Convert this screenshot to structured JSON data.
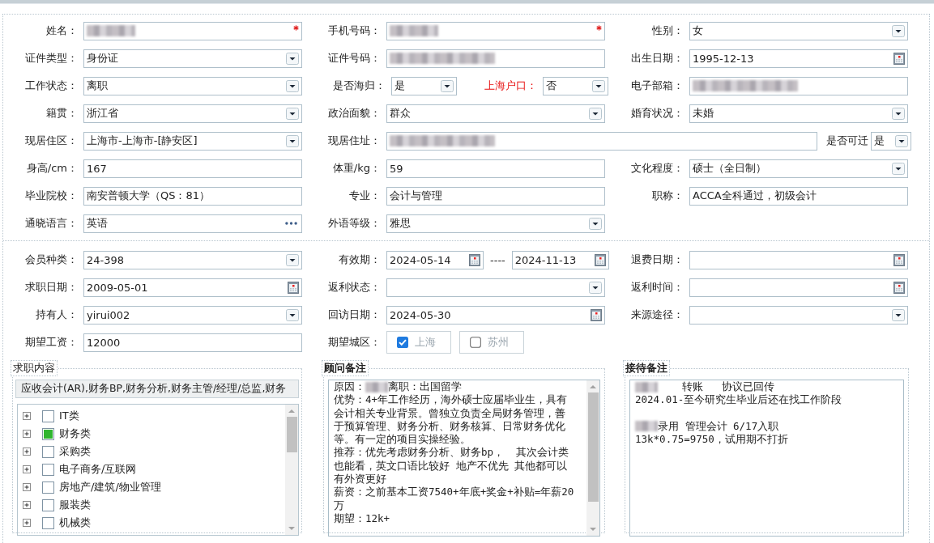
{
  "sections": [
    {
      "rows": [
        [
          {
            "label": "姓名：",
            "kind": "text",
            "redacted": true,
            "required": true
          },
          {
            "label": "手机号码：",
            "kind": "text",
            "redacted": true,
            "required": true
          },
          {
            "label": "性别：",
            "kind": "select",
            "value": "女"
          }
        ],
        [
          {
            "label": "证件类型：",
            "kind": "select",
            "value": "身份证"
          },
          {
            "label": "证件号码：",
            "kind": "text",
            "redacted": true
          },
          {
            "label": "出生日期：",
            "kind": "date",
            "value": "1995-12-13"
          }
        ],
        [
          {
            "label": "工作状态：",
            "kind": "select",
            "value": "离职"
          },
          {
            "label": "是否海归：",
            "kind": "select-short",
            "value": "是"
          },
          {
            "label": "上海户口：",
            "kind": "select-short",
            "value": "否",
            "alert": true
          },
          {
            "label": "电子部箱：",
            "kind": "text",
            "redacted": true
          }
        ],
        [
          {
            "label": "籍贯：",
            "kind": "select",
            "value": "浙江省"
          },
          {
            "label": "政治面貌：",
            "kind": "select",
            "value": "群众"
          },
          {
            "label": "婚育状况：",
            "kind": "select",
            "value": "未婚"
          }
        ],
        [
          {
            "label": "现居住区：",
            "kind": "select",
            "value": "上海市-上海市-[静安区]"
          },
          {
            "label": "现居住址：",
            "kind": "text-wide",
            "redacted": true
          },
          {
            "label": "是否可迁",
            "kind": "select-mini",
            "value": "是"
          }
        ],
        [
          {
            "label": "身高/cm：",
            "kind": "text",
            "value": "167"
          },
          {
            "label": "体重/kg：",
            "kind": "text",
            "value": "59"
          },
          {
            "label": "文化程度：",
            "kind": "select",
            "value": "硕士（全日制）"
          }
        ],
        [
          {
            "label": "毕业院校：",
            "kind": "text",
            "value": "南安普顿大学（QS：81）"
          },
          {
            "label": "专业：",
            "kind": "text",
            "value": "会计与管理"
          },
          {
            "label": "职称：",
            "kind": "text",
            "value": "ACCA全科通过，初级会计"
          }
        ],
        [
          {
            "label": "通晓语言：",
            "kind": "lookup",
            "value": "英语"
          },
          {
            "label": "外语等级：",
            "kind": "select",
            "value": "雅思"
          }
        ]
      ]
    },
    {
      "rows": [
        [
          {
            "label": "会员种类：",
            "kind": "select",
            "value": "24-398"
          },
          {
            "label": "有效期：",
            "kind": "date-range",
            "values": [
              "2024-05-14",
              "2024-11-13"
            ],
            "separator": "----"
          },
          {
            "label": "退费日期：",
            "kind": "date"
          }
        ],
        [
          {
            "label": "求职日期：",
            "kind": "date",
            "value": "2009-05-01"
          },
          {
            "label": "返利状态：",
            "kind": "select"
          },
          {
            "label": "返利时间：",
            "kind": "date"
          }
        ],
        [
          {
            "label": "持有人：",
            "kind": "select",
            "value": "yirui002"
          },
          {
            "label": "回访日期：",
            "kind": "date",
            "value": "2024-05-30"
          },
          {
            "label": "来源途径：",
            "kind": "select"
          }
        ],
        [
          {
            "label": "期望工资：",
            "kind": "text",
            "value": "12000"
          },
          {
            "label": "期望城区：",
            "kind": "options",
            "options": [
              {
                "label": "上海",
                "checked": true
              },
              {
                "label": "苏州",
                "checked": false
              }
            ]
          }
        ]
      ]
    }
  ],
  "panels": [
    {
      "title": "求职内容",
      "emphasis": false,
      "kind": "category-tree",
      "summary": "应收会计(AR),财务BP,财务分析,财务主管/经理/总监,财务",
      "scrollbar": true,
      "items": [
        {
          "label": "IT类",
          "checked": false,
          "expanded": false
        },
        {
          "label": "财务类",
          "checked": true,
          "expanded": false
        },
        {
          "label": "采购类",
          "checked": false,
          "expanded": false
        },
        {
          "label": "电子商务/互联网",
          "checked": false,
          "expanded": false
        },
        {
          "label": "房地产/建筑/物业管理",
          "checked": false,
          "expanded": false
        },
        {
          "label": "服装类",
          "checked": false,
          "expanded": false
        },
        {
          "label": "机械类",
          "checked": false,
          "expanded": false
        }
      ]
    },
    {
      "title": "顾问备注",
      "emphasis": true,
      "kind": "notes",
      "scrollbar": true,
      "lines": [
        {
          "parts": [
            {
              "text": "原因："
            },
            {
              "redacted": true
            },
            {
              "text": "离职：出国留学"
            }
          ]
        },
        {
          "parts": [
            {
              "text": "优势：4+年工作经历，海外硕士应届毕业生，具有"
            }
          ]
        },
        {
          "parts": [
            {
              "text": "会计相关专业背景。曾独立负责全局财务管理，善"
            }
          ]
        },
        {
          "parts": [
            {
              "text": "于预算管理、财务分析、财务核算、日常财务优化"
            }
          ]
        },
        {
          "parts": [
            {
              "text": "等。有一定的项目实操经验。"
            }
          ]
        },
        {
          "parts": [
            {
              "text": "推荐：优先考虑财务分析、财务bp，  其次会计类"
            }
          ]
        },
        {
          "parts": [
            {
              "text": "也能看，英文口语比较好 地产不优先 其他都可以"
            }
          ]
        },
        {
          "parts": [
            {
              "text": "有外资更好"
            }
          ]
        },
        {
          "parts": [
            {
              "text": "薪资：之前基本工资7540+年底+奖金+补贴=年薪20"
            }
          ]
        },
        {
          "parts": [
            {
              "text": "万"
            }
          ]
        },
        {
          "parts": [
            {
              "text": "期望：12k+"
            }
          ]
        }
      ]
    },
    {
      "title": "接待备注",
      "emphasis": true,
      "kind": "notes",
      "scrollbar": false,
      "lines": [
        {
          "parts": [
            {
              "redacted": true
            },
            {
              "text": "    转账   协议已回传"
            }
          ]
        },
        {
          "parts": [
            {
              "text": "2024.01-至今研究生毕业后还在找工作阶段"
            }
          ]
        },
        {
          "gap_before": true,
          "parts": [
            {
              "redacted": true
            },
            {
              "text": "录用 管理会计 6/17入职"
            }
          ]
        },
        {
          "parts": [
            {
              "text": "13k*0.75=9750，试用期不打折"
            }
          ]
        }
      ]
    }
  ]
}
